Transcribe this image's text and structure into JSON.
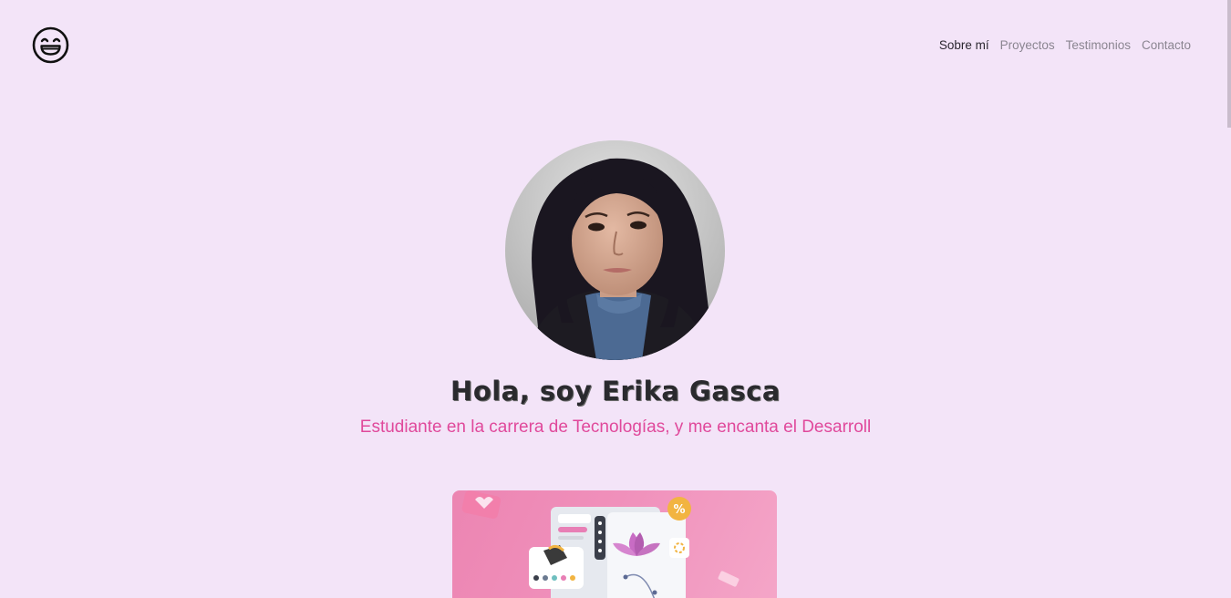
{
  "header": {
    "logo_icon": "grinning-face-icon",
    "nav": [
      {
        "label": "Sobre mí",
        "active": true
      },
      {
        "label": "Proyectos",
        "active": false
      },
      {
        "label": "Testimonios",
        "active": false
      },
      {
        "label": "Contacto",
        "active": false
      }
    ]
  },
  "hero": {
    "title": "Hola, soy Erika Gasca",
    "subtitle": "Estudiante en la carrera de Tecnologías, y me encanta el Desarroll"
  },
  "colors": {
    "background": "#f3e4f8",
    "accent": "#e0499b",
    "card": "#f090bb"
  }
}
